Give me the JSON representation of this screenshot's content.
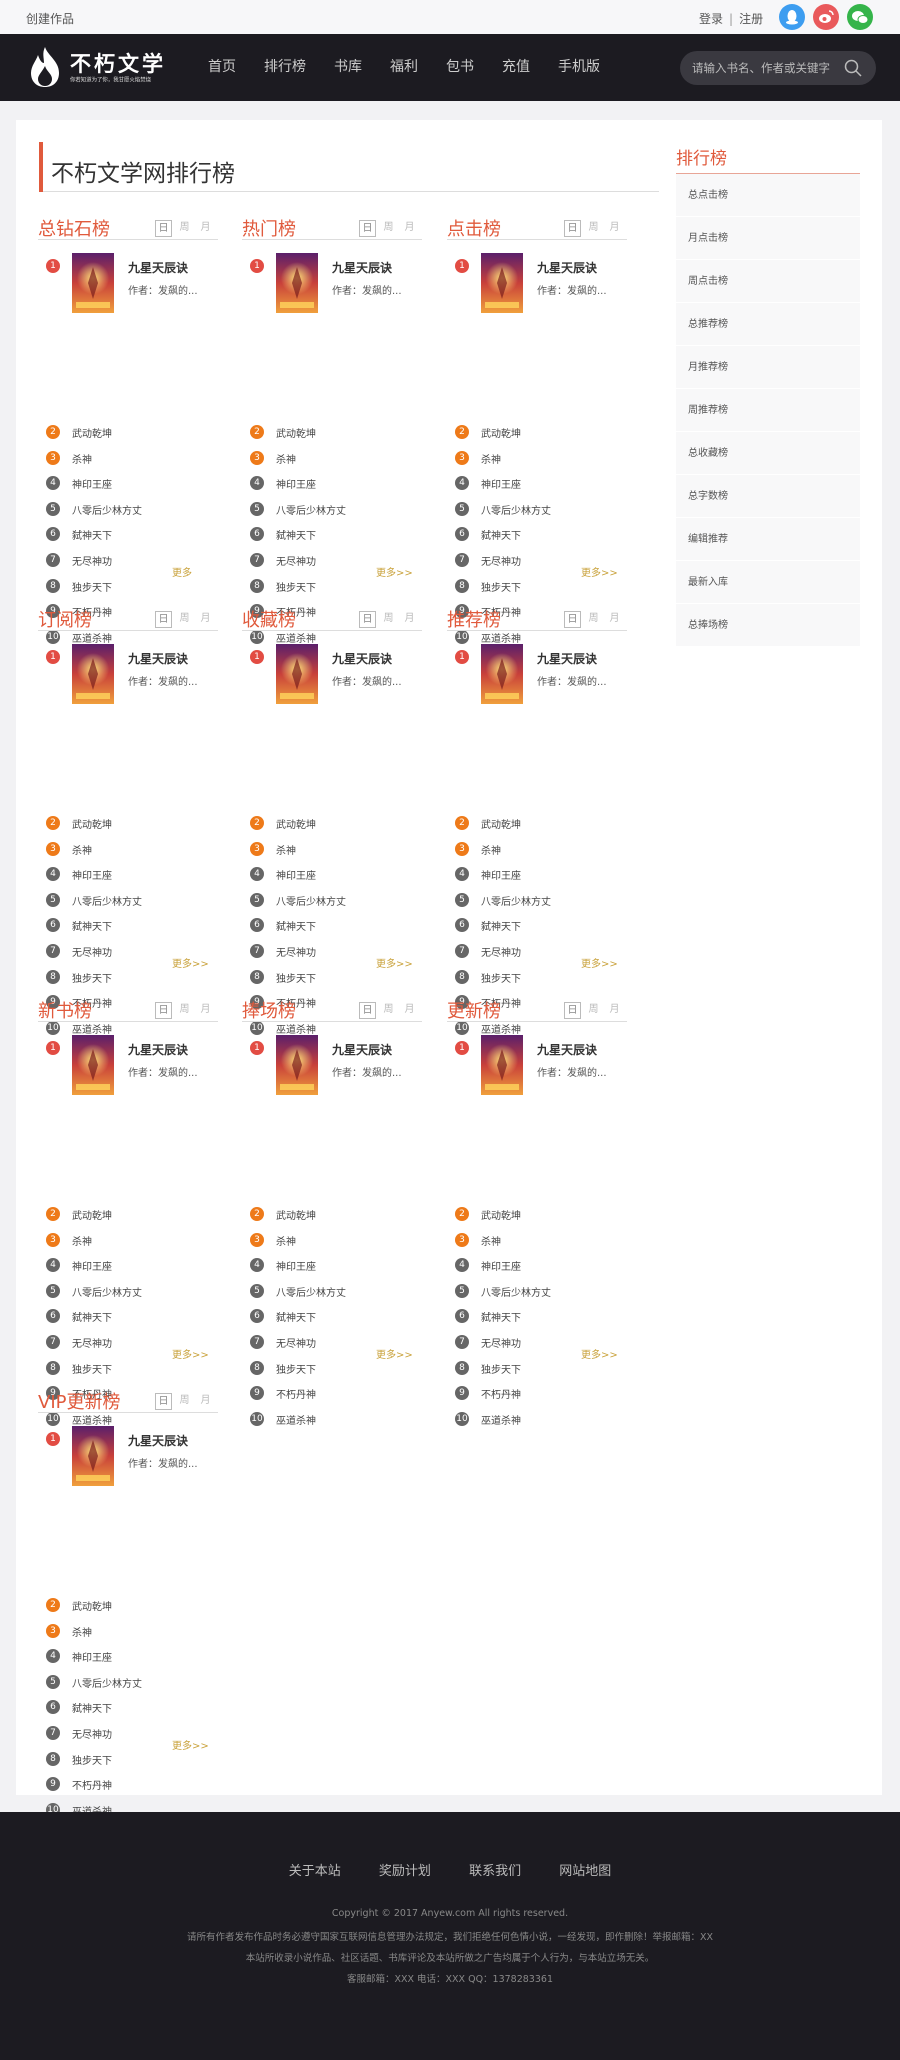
{
  "topbar": {
    "create_label": "创建作品",
    "login_label": "登录",
    "separator": "|",
    "register_label": "注册"
  },
  "header": {
    "logo_name": "不朽文学",
    "logo_slogan": "你若知道为了你，我甘愿火焰焚烧",
    "nav": [
      "首页",
      "排行榜",
      "书库",
      "福利",
      "包书",
      "充值",
      "手机版"
    ],
    "search_placeholder": "请输入书名、作者或关键字"
  },
  "page_title": "不朽文学网排行榜",
  "tabs": [
    "日",
    "周",
    "月"
  ],
  "featured": {
    "title": "九星天辰诀",
    "author": "作者：发飙的..."
  },
  "items": [
    "武动乾坤",
    "杀神",
    "神印王座",
    "八零后少林方丈",
    "弑神天下",
    "无尽神功",
    "独步天下",
    "不朽丹神",
    "巫道杀神"
  ],
  "boards": [
    {
      "title": "总钻石榜",
      "more": "更多"
    },
    {
      "title": "热门榜",
      "more": "更多>>"
    },
    {
      "title": "点击榜",
      "more": "更多>>"
    },
    {
      "title": "订阅榜",
      "more": "更多>>"
    },
    {
      "title": "收藏榜",
      "more": "更多>>"
    },
    {
      "title": "推荐榜",
      "more": "更多>>"
    },
    {
      "title": "新书榜",
      "more": "更多>>"
    },
    {
      "title": "捧场榜",
      "more": "更多>>"
    },
    {
      "title": "更新榜",
      "more": "更多>>"
    },
    {
      "title": "VIP更新榜",
      "more": "更多>>"
    }
  ],
  "sidebar": {
    "title": "排行榜",
    "items": [
      "总点击榜",
      "月点击榜",
      "周点击榜",
      "总推荐榜",
      "月推荐榜",
      "周推荐榜",
      "总收藏榜",
      "总字数榜",
      "编辑推荐",
      "最新入库",
      "总捧场榜"
    ]
  },
  "footer": {
    "links": [
      "关于本站",
      "奖励计划",
      "联系我们",
      "网站地图"
    ],
    "copyright": "Copyright © 2017 Anyew.com All rights reserved.",
    "notice": "请所有作者发布作品时务必遵守国家互联网信息管理办法规定，我们拒绝任何色情小说，一经发现，即作删除！举报邮箱：XX",
    "disclaimer": "本站所收录小说作品、社区话题、书库评论及本站所做之广告均属于个人行为，与本站立场无关。",
    "contact": "客服邮箱：XXX 电话：XXX QQ：1378283361"
  },
  "colors": {
    "accent": "#e05a3c",
    "header_bg": "#1c1b21",
    "more_link": "#c9a23b",
    "rank1": "#e24c43",
    "rank2_3": "#ee7a19",
    "rank_other": "#666666"
  }
}
